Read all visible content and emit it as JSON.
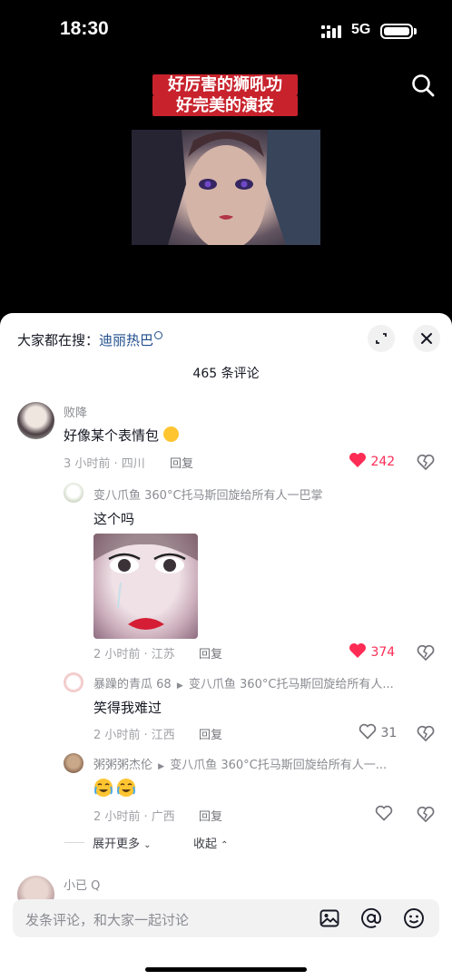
{
  "status_bar": {
    "time": "18:30",
    "network": "5G"
  },
  "video": {
    "caption_line1": "好厉害的狮吼功",
    "caption_line2": "好完美的演技"
  },
  "comments_panel": {
    "hot_search_prefix": "大家都在搜：",
    "hot_search_keyword": "迪丽热巴",
    "count_label": "465 条评论",
    "comments": [
      {
        "user": "败降",
        "text": "好像某个表情包",
        "meta": "3 小时前 · 四川",
        "reply_label": "回复",
        "likes": "242"
      }
    ],
    "replies": [
      {
        "user": "变八爪鱼 360°C托马斯回旋给所有人一巴掌",
        "text": "这个吗",
        "meta": "2 小时前 · 江苏",
        "reply_label": "回复",
        "likes": "374"
      },
      {
        "user": "暴躁的青瓜 68",
        "reply_to": "变八爪鱼 360°C托马斯回旋给所有人...",
        "text": "笑得我难过",
        "meta": "2 小时前 · 江西",
        "reply_label": "回复",
        "likes": "31"
      },
      {
        "user": "粥粥粥杰伦",
        "reply_to": "变八爪鱼 360°C托马斯回旋给所有人一...",
        "text": "",
        "meta": "2 小时前 · 广西",
        "reply_label": "回复",
        "likes": ""
      }
    ],
    "expand_more": "展开更多",
    "collapse": "收起",
    "next_user": "小已 Q"
  },
  "input": {
    "placeholder": "发条评论，和大家一起讨论"
  },
  "colors": {
    "like_red": "#fe2c55",
    "caption_bg": "#c8232d",
    "keyword_blue": "#1f4e8c"
  }
}
